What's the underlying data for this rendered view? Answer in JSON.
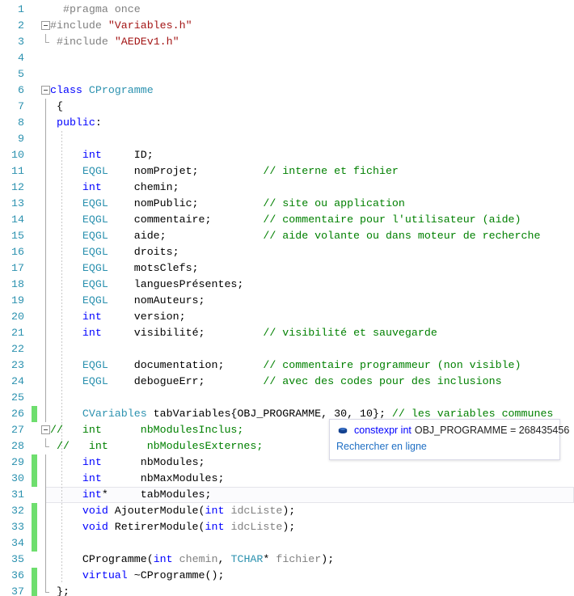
{
  "editor": {
    "app": "visual-studio-code-editor",
    "language": "C++",
    "first_line": 1,
    "last_line": 37,
    "colors": {
      "background": "#ffffff",
      "line_number": "#2b91af",
      "keyword": "#0000ff",
      "comment": "#008000",
      "string": "#a31515",
      "type": "#2b91af",
      "preprocessor": "#808080",
      "parameter": "#808080",
      "change_bar_saved": "#6ede6e",
      "current_line_border": "#e4e4ea"
    },
    "current_line": 31,
    "lines": [
      {
        "n": 1,
        "change": "none",
        "outline": "none",
        "indent_guide": false,
        "tokens": [
          {
            "t": "  ",
            "c": "punct"
          },
          {
            "t": "#pragma once",
            "c": "pre"
          }
        ]
      },
      {
        "n": 2,
        "change": "none",
        "outline": "collapse",
        "indent_guide": false,
        "tokens": [
          {
            "t": "#include ",
            "c": "pre"
          },
          {
            "t": "\"Variables.h\"",
            "c": "str"
          }
        ]
      },
      {
        "n": 3,
        "change": "none",
        "outline": "line-end",
        "indent_guide": false,
        "tokens": [
          {
            "t": " ",
            "c": "punct"
          },
          {
            "t": "#include ",
            "c": "pre"
          },
          {
            "t": "\"AEDEv1.h\"",
            "c": "str"
          }
        ]
      },
      {
        "n": 4,
        "change": "none",
        "outline": "none",
        "indent_guide": false,
        "tokens": []
      },
      {
        "n": 5,
        "change": "none",
        "outline": "none",
        "indent_guide": false,
        "tokens": []
      },
      {
        "n": 6,
        "change": "none",
        "outline": "collapse",
        "indent_guide": false,
        "tokens": [
          {
            "t": "class ",
            "c": "kw"
          },
          {
            "t": "CProgramme",
            "c": "typ"
          }
        ]
      },
      {
        "n": 7,
        "change": "none",
        "outline": "line",
        "indent_guide": false,
        "tokens": [
          {
            "t": " {",
            "c": "punct"
          }
        ]
      },
      {
        "n": 8,
        "change": "none",
        "outline": "line",
        "indent_guide": false,
        "tokens": [
          {
            "t": " ",
            "c": "punct"
          },
          {
            "t": "public",
            "c": "kw"
          },
          {
            "t": ":",
            "c": "punct"
          }
        ]
      },
      {
        "n": 9,
        "change": "none",
        "outline": "line",
        "indent_guide": true,
        "tokens": []
      },
      {
        "n": 10,
        "change": "none",
        "outline": "line",
        "indent_guide": true,
        "tokens": [
          {
            "t": "     ",
            "c": "punct"
          },
          {
            "t": "int",
            "c": "kw"
          },
          {
            "t": "     ID;",
            "c": "id"
          }
        ]
      },
      {
        "n": 11,
        "change": "none",
        "outline": "line",
        "indent_guide": true,
        "tokens": [
          {
            "t": "     ",
            "c": "punct"
          },
          {
            "t": "EQGL",
            "c": "typ"
          },
          {
            "t": "    nomProjet;          ",
            "c": "id"
          },
          {
            "t": "// interne et fichier",
            "c": "cmt"
          }
        ]
      },
      {
        "n": 12,
        "change": "none",
        "outline": "line",
        "indent_guide": true,
        "tokens": [
          {
            "t": "     ",
            "c": "punct"
          },
          {
            "t": "int",
            "c": "kw"
          },
          {
            "t": "     chemin;",
            "c": "id"
          }
        ]
      },
      {
        "n": 13,
        "change": "none",
        "outline": "line",
        "indent_guide": true,
        "tokens": [
          {
            "t": "     ",
            "c": "punct"
          },
          {
            "t": "EQGL",
            "c": "typ"
          },
          {
            "t": "    nomPublic;          ",
            "c": "id"
          },
          {
            "t": "// site ou application",
            "c": "cmt"
          }
        ]
      },
      {
        "n": 14,
        "change": "none",
        "outline": "line",
        "indent_guide": true,
        "tokens": [
          {
            "t": "     ",
            "c": "punct"
          },
          {
            "t": "EQGL",
            "c": "typ"
          },
          {
            "t": "    commentaire;        ",
            "c": "id"
          },
          {
            "t": "// commentaire pour l'utilisateur (aide)",
            "c": "cmt"
          }
        ]
      },
      {
        "n": 15,
        "change": "none",
        "outline": "line",
        "indent_guide": true,
        "tokens": [
          {
            "t": "     ",
            "c": "punct"
          },
          {
            "t": "EQGL",
            "c": "typ"
          },
          {
            "t": "    aide;               ",
            "c": "id"
          },
          {
            "t": "// aide volante ou dans moteur de recherche",
            "c": "cmt"
          }
        ]
      },
      {
        "n": 16,
        "change": "none",
        "outline": "line",
        "indent_guide": true,
        "tokens": [
          {
            "t": "     ",
            "c": "punct"
          },
          {
            "t": "EQGL",
            "c": "typ"
          },
          {
            "t": "    droits;",
            "c": "id"
          }
        ]
      },
      {
        "n": 17,
        "change": "none",
        "outline": "line",
        "indent_guide": true,
        "tokens": [
          {
            "t": "     ",
            "c": "punct"
          },
          {
            "t": "EQGL",
            "c": "typ"
          },
          {
            "t": "    motsClefs;",
            "c": "id"
          }
        ]
      },
      {
        "n": 18,
        "change": "none",
        "outline": "line",
        "indent_guide": true,
        "tokens": [
          {
            "t": "     ",
            "c": "punct"
          },
          {
            "t": "EQGL",
            "c": "typ"
          },
          {
            "t": "    languesPrésentes;",
            "c": "id"
          }
        ]
      },
      {
        "n": 19,
        "change": "none",
        "outline": "line",
        "indent_guide": true,
        "tokens": [
          {
            "t": "     ",
            "c": "punct"
          },
          {
            "t": "EQGL",
            "c": "typ"
          },
          {
            "t": "    nomAuteurs;",
            "c": "id"
          }
        ]
      },
      {
        "n": 20,
        "change": "none",
        "outline": "line",
        "indent_guide": true,
        "tokens": [
          {
            "t": "     ",
            "c": "punct"
          },
          {
            "t": "int",
            "c": "kw"
          },
          {
            "t": "     version;",
            "c": "id"
          }
        ]
      },
      {
        "n": 21,
        "change": "none",
        "outline": "line",
        "indent_guide": true,
        "tokens": [
          {
            "t": "     ",
            "c": "punct"
          },
          {
            "t": "int",
            "c": "kw"
          },
          {
            "t": "     visibilité;         ",
            "c": "id"
          },
          {
            "t": "// visibilité et sauvegarde",
            "c": "cmt"
          }
        ]
      },
      {
        "n": 22,
        "change": "none",
        "outline": "line",
        "indent_guide": true,
        "tokens": []
      },
      {
        "n": 23,
        "change": "none",
        "outline": "line",
        "indent_guide": true,
        "tokens": [
          {
            "t": "     ",
            "c": "punct"
          },
          {
            "t": "EQGL",
            "c": "typ"
          },
          {
            "t": "    documentation;      ",
            "c": "id"
          },
          {
            "t": "// commentaire programmeur (non visible)",
            "c": "cmt"
          }
        ]
      },
      {
        "n": 24,
        "change": "none",
        "outline": "line",
        "indent_guide": true,
        "tokens": [
          {
            "t": "     ",
            "c": "punct"
          },
          {
            "t": "EQGL",
            "c": "typ"
          },
          {
            "t": "    debogueErr;         ",
            "c": "id"
          },
          {
            "t": "// avec des codes pour des inclusions",
            "c": "cmt"
          }
        ]
      },
      {
        "n": 25,
        "change": "none",
        "outline": "line",
        "indent_guide": true,
        "tokens": []
      },
      {
        "n": 26,
        "change": "green",
        "outline": "line",
        "indent_guide": true,
        "tokens": [
          {
            "t": "     ",
            "c": "punct"
          },
          {
            "t": "CVariables",
            "c": "typ"
          },
          {
            "t": " tabVariables{OBJ_PROGRAMME, 30, 10}; ",
            "c": "id"
          },
          {
            "t": "// les variables communes",
            "c": "cmt"
          }
        ]
      },
      {
        "n": 27,
        "change": "none",
        "outline": "collapse",
        "indent_guide": true,
        "tokens": [
          {
            "t": "//   int      nbModulesInclus;",
            "c": "cmt"
          }
        ]
      },
      {
        "n": 28,
        "change": "none",
        "outline": "line-end",
        "indent_guide": true,
        "tokens": [
          {
            "t": " //   int      nbModulesExternes;",
            "c": "cmt"
          }
        ]
      },
      {
        "n": 29,
        "change": "green",
        "outline": "line",
        "indent_guide": true,
        "tokens": [
          {
            "t": "     ",
            "c": "punct"
          },
          {
            "t": "int",
            "c": "kw"
          },
          {
            "t": "      nbModules;",
            "c": "id"
          }
        ]
      },
      {
        "n": 30,
        "change": "green",
        "outline": "line",
        "indent_guide": true,
        "tokens": [
          {
            "t": "     ",
            "c": "punct"
          },
          {
            "t": "int",
            "c": "kw"
          },
          {
            "t": "      nbMaxModules;",
            "c": "id"
          }
        ]
      },
      {
        "n": 31,
        "change": "none",
        "outline": "line",
        "indent_guide": true,
        "current": true,
        "tokens": [
          {
            "t": "     ",
            "c": "punct"
          },
          {
            "t": "int",
            "c": "kw"
          },
          {
            "t": "*",
            "c": "punct"
          },
          {
            "t": "     tabModules;",
            "c": "id"
          }
        ]
      },
      {
        "n": 32,
        "change": "green",
        "outline": "line",
        "indent_guide": true,
        "tokens": [
          {
            "t": "     ",
            "c": "punct"
          },
          {
            "t": "void",
            "c": "kw"
          },
          {
            "t": " AjouterModule(",
            "c": "id"
          },
          {
            "t": "int",
            "c": "kw"
          },
          {
            "t": " ",
            "c": "id"
          },
          {
            "t": "idcListe",
            "c": "pid"
          },
          {
            "t": ");",
            "c": "id"
          }
        ]
      },
      {
        "n": 33,
        "change": "green",
        "outline": "line",
        "indent_guide": true,
        "tokens": [
          {
            "t": "     ",
            "c": "punct"
          },
          {
            "t": "void",
            "c": "kw"
          },
          {
            "t": " RetirerModule(",
            "c": "id"
          },
          {
            "t": "int",
            "c": "kw"
          },
          {
            "t": " ",
            "c": "id"
          },
          {
            "t": "idcListe",
            "c": "pid"
          },
          {
            "t": ");",
            "c": "id"
          }
        ]
      },
      {
        "n": 34,
        "change": "green",
        "outline": "line",
        "indent_guide": true,
        "tokens": []
      },
      {
        "n": 35,
        "change": "none",
        "outline": "line",
        "indent_guide": true,
        "tokens": [
          {
            "t": "     ",
            "c": "punct"
          },
          {
            "t": "CProgramme(",
            "c": "id"
          },
          {
            "t": "int",
            "c": "kw"
          },
          {
            "t": " ",
            "c": "id"
          },
          {
            "t": "chemin",
            "c": "pid"
          },
          {
            "t": ", ",
            "c": "id"
          },
          {
            "t": "TCHAR",
            "c": "typ"
          },
          {
            "t": "* ",
            "c": "id"
          },
          {
            "t": "fichier",
            "c": "pid"
          },
          {
            "t": ");",
            "c": "id"
          }
        ]
      },
      {
        "n": 36,
        "change": "green",
        "outline": "line",
        "indent_guide": true,
        "tokens": [
          {
            "t": "     ",
            "c": "punct"
          },
          {
            "t": "virtual",
            "c": "kw"
          },
          {
            "t": " ~CProgramme();",
            "c": "id"
          }
        ]
      },
      {
        "n": 37,
        "change": "green",
        "outline": "line-end",
        "indent_guide": false,
        "tokens": [
          {
            "t": " };",
            "c": "id"
          }
        ]
      }
    ]
  },
  "tooltip": {
    "name": "quick-info-tooltip",
    "icon": "constant-field-icon",
    "keyword": "constexpr int",
    "declaration": "OBJ_PROGRAMME = 268435456",
    "link_label": "Rechercher en ligne"
  }
}
